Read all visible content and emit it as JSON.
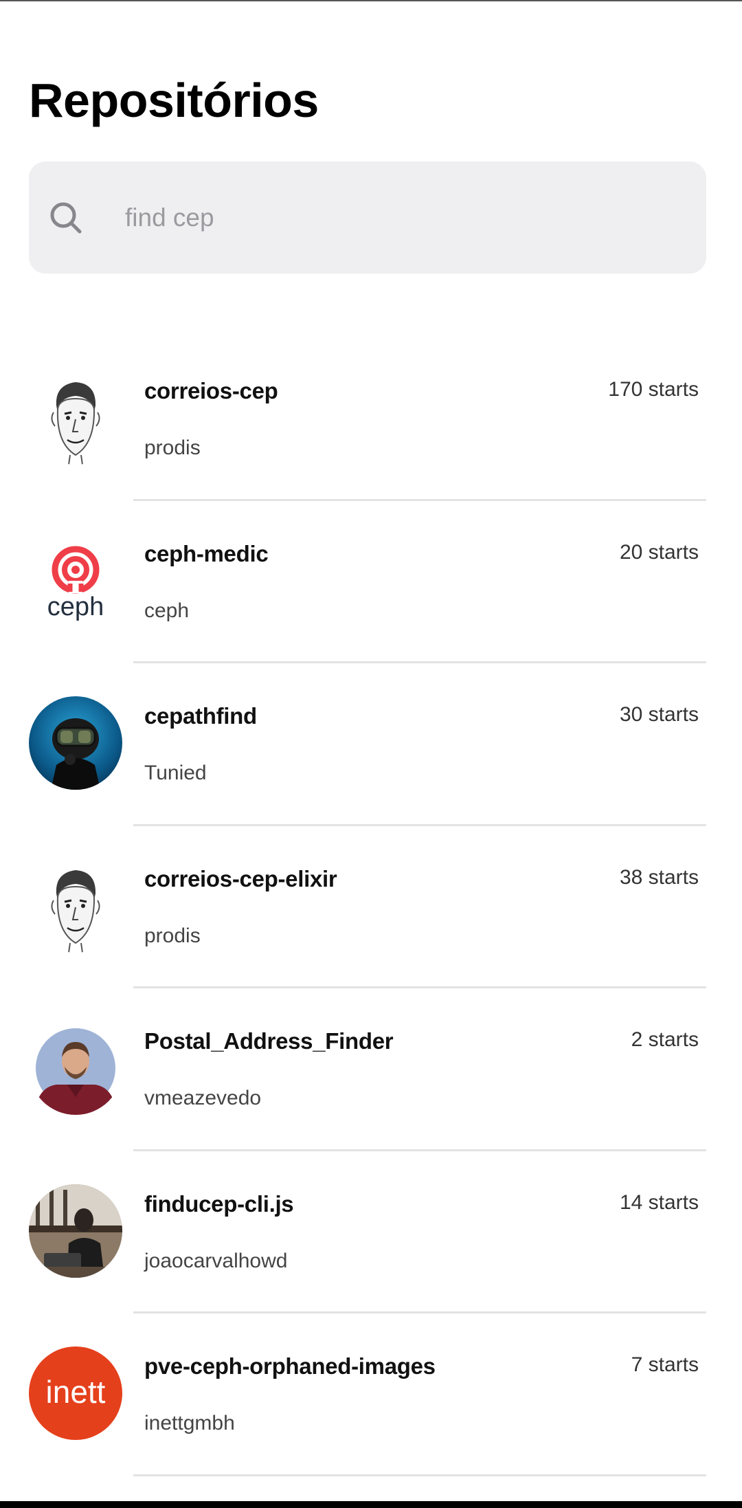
{
  "header": {
    "title": "Repositórios"
  },
  "search": {
    "value": "",
    "placeholder": "find cep",
    "icon": "search-icon"
  },
  "repositories": [
    {
      "name": "correios-cep",
      "owner": "prodis",
      "stars": "170 starts",
      "avatar": "caricature-avatar"
    },
    {
      "name": "ceph-medic",
      "owner": "ceph",
      "stars": "20 starts",
      "avatar": "ceph-logo",
      "avatar_text": "ceph"
    },
    {
      "name": "cepathfind",
      "owner": "Tunied",
      "stars": "30 starts",
      "avatar": "diver-photo"
    },
    {
      "name": "correios-cep-elixir",
      "owner": "prodis",
      "stars": "38 starts",
      "avatar": "caricature-avatar"
    },
    {
      "name": "Postal_Address_Finder",
      "owner": "vmeazevedo",
      "stars": "2 starts",
      "avatar": "person-photo"
    },
    {
      "name": "finducep-cli.js",
      "owner": "joaocarvalhowd",
      "stars": "14 starts",
      "avatar": "person-laptop-photo"
    },
    {
      "name": "pve-ceph-orphaned-images",
      "owner": "inettgmbh",
      "stars": "7 starts",
      "avatar": "inett-logo",
      "avatar_text": "inett"
    }
  ],
  "colors": {
    "search_background": "#efeff1",
    "divider": "#e3e3e3",
    "ceph_red": "#ef3e48",
    "ceph_dark": "#232f3e",
    "inett_orange": "#e5401c"
  }
}
